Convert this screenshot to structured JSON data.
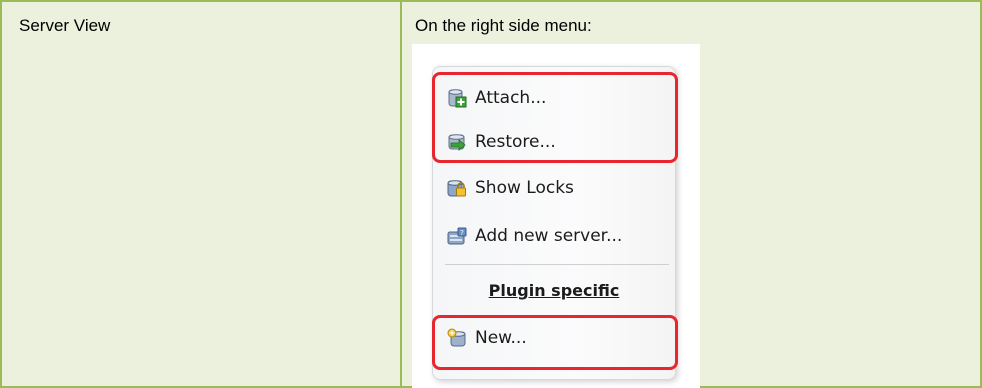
{
  "table": {
    "left_cell_text": "Server View",
    "right_cell_text": "On the right side menu:"
  },
  "menu": {
    "items": [
      {
        "label": "Attach...",
        "icon": "database-attach-icon"
      },
      {
        "label": "Restore...",
        "icon": "database-restore-icon"
      },
      {
        "label": "Show Locks",
        "icon": "database-lock-icon"
      },
      {
        "label": "Add new server...",
        "icon": "server-add-icon"
      }
    ],
    "section_header": "Plugin specific",
    "plugin_items": [
      {
        "label": "New...",
        "icon": "database-new-icon"
      }
    ]
  },
  "colors": {
    "table_border": "#9bbb59",
    "table_fill": "#ebf1dd",
    "highlight": "#e8262e"
  }
}
